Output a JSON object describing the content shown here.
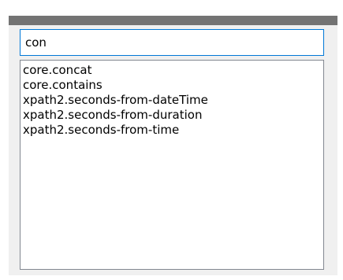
{
  "search": {
    "value": "con"
  },
  "list": {
    "items": [
      "core.concat",
      "core.contains",
      "xpath2.seconds-from-dateTime",
      "xpath2.seconds-from-duration",
      "xpath2.seconds-from-time"
    ]
  },
  "colors": {
    "titlebar": "#737373",
    "panel_background": "#f0f0f0",
    "input_border_focus": "#0078d7",
    "list_border": "#828790"
  }
}
